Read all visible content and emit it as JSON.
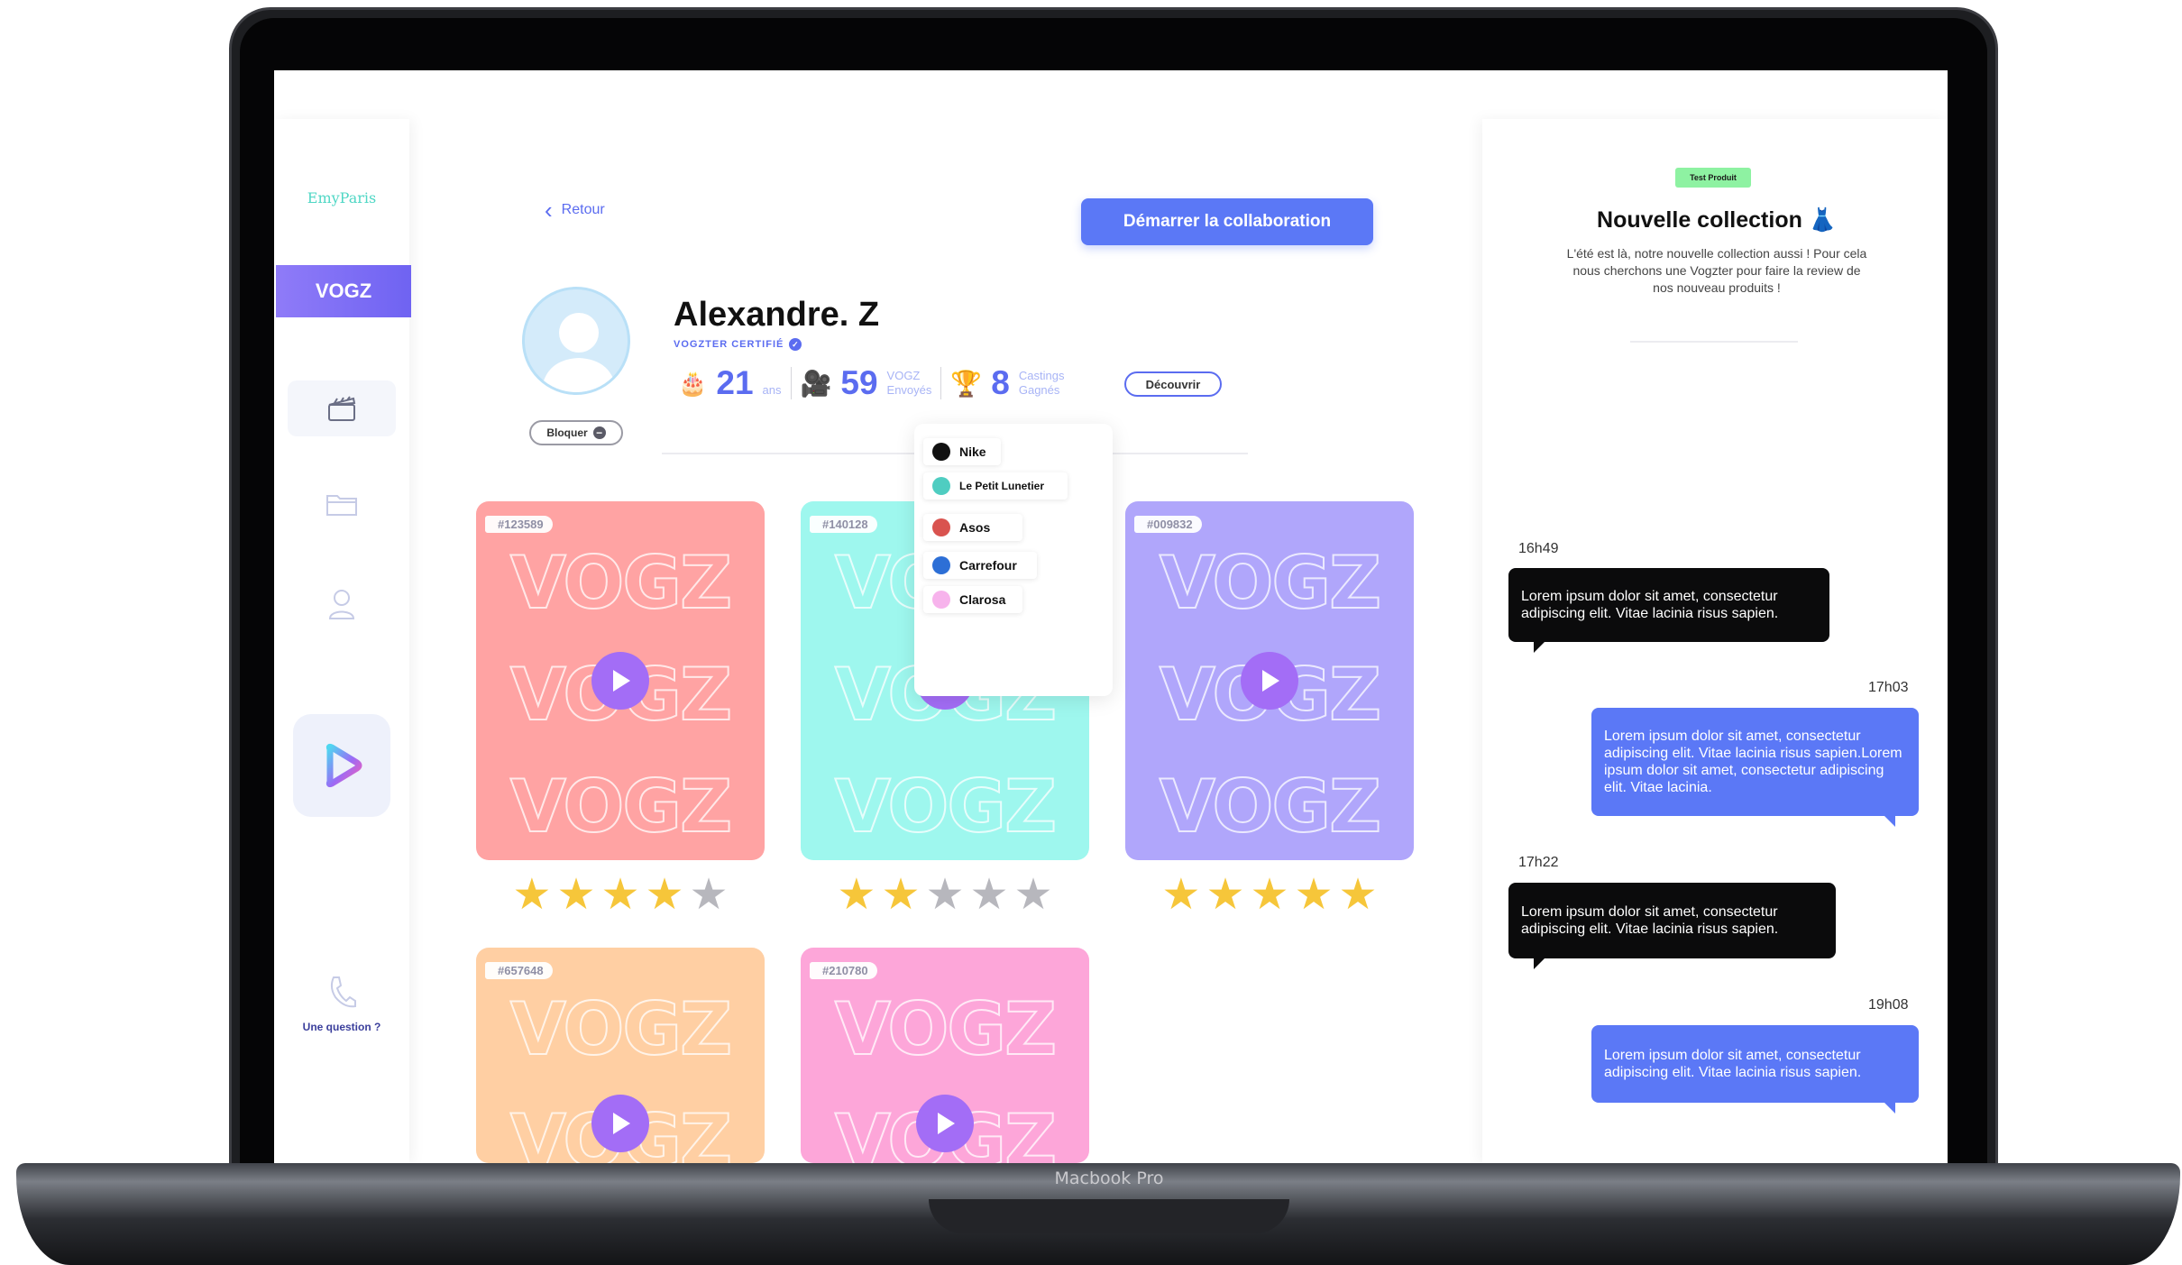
{
  "device": {
    "brand_label": "Macbook Pro"
  },
  "sidebar": {
    "logo": "EmyParis",
    "brand_button": "VOGZ",
    "help_label": "Une question ?",
    "nav_icons": [
      "clapperboard-icon",
      "folder-icon",
      "user-icon",
      "play-icon"
    ]
  },
  "header": {
    "back_label": "Retour",
    "cta_label": "Démarrer la collaboration"
  },
  "profile": {
    "name": "Alexandre. Z",
    "certified_label": "VOGZTER CERTIFIÉ",
    "block_label": "Bloquer",
    "age_value": "21",
    "age_unit": "ans",
    "vogz_value": "59",
    "vogz_unit_1": "VOGZ",
    "vogz_unit_2": "Envoyés",
    "castings_value": "8",
    "castings_unit_1": "Castings",
    "castings_unit_2": "Gagnés",
    "discover_label": "Découvrir"
  },
  "brands_dropdown": [
    {
      "label": "Nike",
      "color": "#111111"
    },
    {
      "label": "Le Petit Lunetier",
      "color": "#4fcdc1"
    },
    {
      "label": "Asos",
      "color": "#d9534f"
    },
    {
      "label": "Carrefour",
      "color": "#2d6fd6"
    },
    {
      "label": "Clarosa",
      "color": "#f7b3ec"
    }
  ],
  "videos": [
    {
      "id": "#123589",
      "color": "#ffa3a3",
      "rating": 4,
      "watermark": "VOGZ"
    },
    {
      "id": "#140128",
      "color": "#9ef7ee",
      "rating": 2,
      "watermark": "VOGZ"
    },
    {
      "id": "#009832",
      "color": "#b0a6fb",
      "rating": 5,
      "watermark": "VOGZ"
    },
    {
      "id": "#657648",
      "color": "#ffcfa3",
      "rating": null,
      "watermark": "VOGZ"
    },
    {
      "id": "#210780",
      "color": "#fda6d9",
      "rating": null,
      "watermark": "VOGZ"
    }
  ],
  "right_panel": {
    "pill": "Test Produit",
    "title": "Nouvelle collection",
    "description": "L'été est là, notre nouvelle collection aussi ! Pour cela nous cherchons une Vogzter pour faire la review de nos nouveau produits !",
    "messages": [
      {
        "time": "16h49",
        "direction": "in",
        "text": "Lorem ipsum dolor sit amet, consectetur adipiscing elit. Vitae lacinia risus sapien."
      },
      {
        "time": "17h03",
        "direction": "out",
        "text": "Lorem ipsum dolor sit amet, consectetur adipiscing elit. Vitae lacinia risus sapien.Lorem ipsum dolor sit amet, consectetur adipiscing elit. Vitae lacinia."
      },
      {
        "time": "17h22",
        "direction": "in",
        "text": "Lorem ipsum dolor sit amet, consectetur adipiscing elit. Vitae lacinia risus sapien."
      },
      {
        "time": "19h08",
        "direction": "out",
        "text": "Lorem ipsum dolor sit amet, consectetur adipiscing elit. Vitae lacinia risus sapien."
      }
    ]
  },
  "colors": {
    "accent": "#5b78f6",
    "brand_purple": "#7a6cf5",
    "star_on": "#f6c63a",
    "star_off": "#b7b7bd"
  }
}
